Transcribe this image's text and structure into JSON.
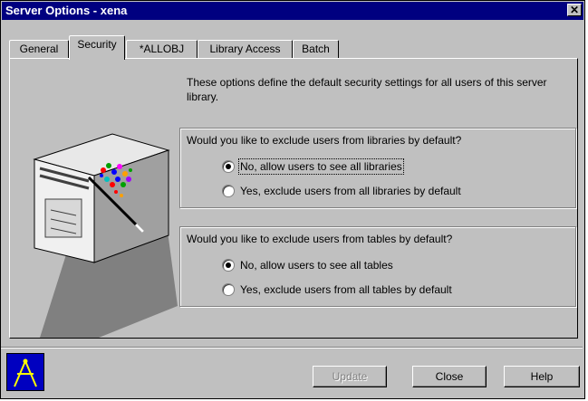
{
  "window": {
    "title": "Server Options - xena",
    "close_label": "✕"
  },
  "tabs": [
    {
      "label": "General"
    },
    {
      "label": "Security"
    },
    {
      "label": "*ALLOBJ"
    },
    {
      "label": "Library Access"
    },
    {
      "label": "Batch"
    }
  ],
  "active_tab": "Security",
  "description": "These options define the default security settings for all users of this server library.",
  "libraries": {
    "question": "Would you like to exclude users from libraries by default?",
    "options": [
      {
        "label": "No, allow users to see all libraries",
        "selected": true
      },
      {
        "label": "Yes, exclude users from all libraries by default",
        "selected": false
      }
    ]
  },
  "tables": {
    "question": "Would you like to exclude users from tables by default?",
    "options": [
      {
        "label": "No, allow users to see all tables",
        "selected": true
      },
      {
        "label": "Yes, exclude users from all tables by default",
        "selected": false
      }
    ]
  },
  "buttons": {
    "update": "Update",
    "close": "Close",
    "help": "Help"
  },
  "colors": {
    "titlebar": "#000080",
    "face": "#c0c0c0",
    "logo_bg": "#0000c0",
    "logo_fg": "#ffff00"
  }
}
